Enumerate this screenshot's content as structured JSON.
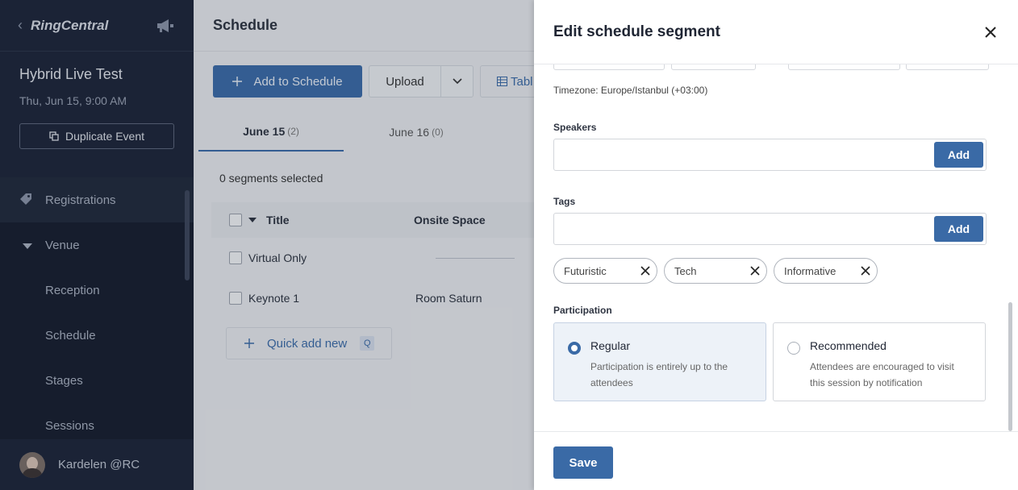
{
  "sidebar": {
    "logo": "RingCentral",
    "event_title": "Hybrid Live Test",
    "event_date": "Thu, Jun 15, 9:00 AM",
    "duplicate_label": "Duplicate Event",
    "items": [
      {
        "label": "Registrations"
      },
      {
        "label": "Venue"
      },
      {
        "label": "Reception"
      },
      {
        "label": "Schedule"
      },
      {
        "label": "Stages"
      },
      {
        "label": "Sessions"
      }
    ],
    "user": "Kardelen @RC"
  },
  "main": {
    "title": "Schedule",
    "toolbar": {
      "add_label": "Add to Schedule",
      "upload_label": "Upload",
      "table_label": "Tabl"
    },
    "tabs": [
      {
        "label": "June 15",
        "count": "(2)"
      },
      {
        "label": "June 16",
        "count": "(0)"
      }
    ],
    "selected_text": "0 segments selected",
    "columns": [
      "Title",
      "Onsite Space"
    ],
    "rows": [
      {
        "title": "Virtual Only",
        "space": ""
      },
      {
        "title": "Keynote 1",
        "space": "Room Saturn"
      }
    ],
    "quick_add": "Quick add new",
    "quick_key": "Q"
  },
  "panel": {
    "title": "Edit schedule segment",
    "timezone": "Timezone: Europe/Istanbul (+03:00)",
    "speakers_label": "Speakers",
    "tags_label": "Tags",
    "add_label": "Add",
    "tags": [
      "Futuristic",
      "Tech",
      "Informative"
    ],
    "participation_label": "Participation",
    "options": [
      {
        "title": "Regular",
        "desc": "Participation is entirely up to the attendees",
        "selected": true
      },
      {
        "title": "Recommended",
        "desc": "Attendees are encouraged to visit this session by notification",
        "selected": false
      }
    ],
    "save_label": "Save"
  },
  "colors": {
    "accent": "#3a6aa6",
    "sidebar_bg": "#1b2336"
  }
}
